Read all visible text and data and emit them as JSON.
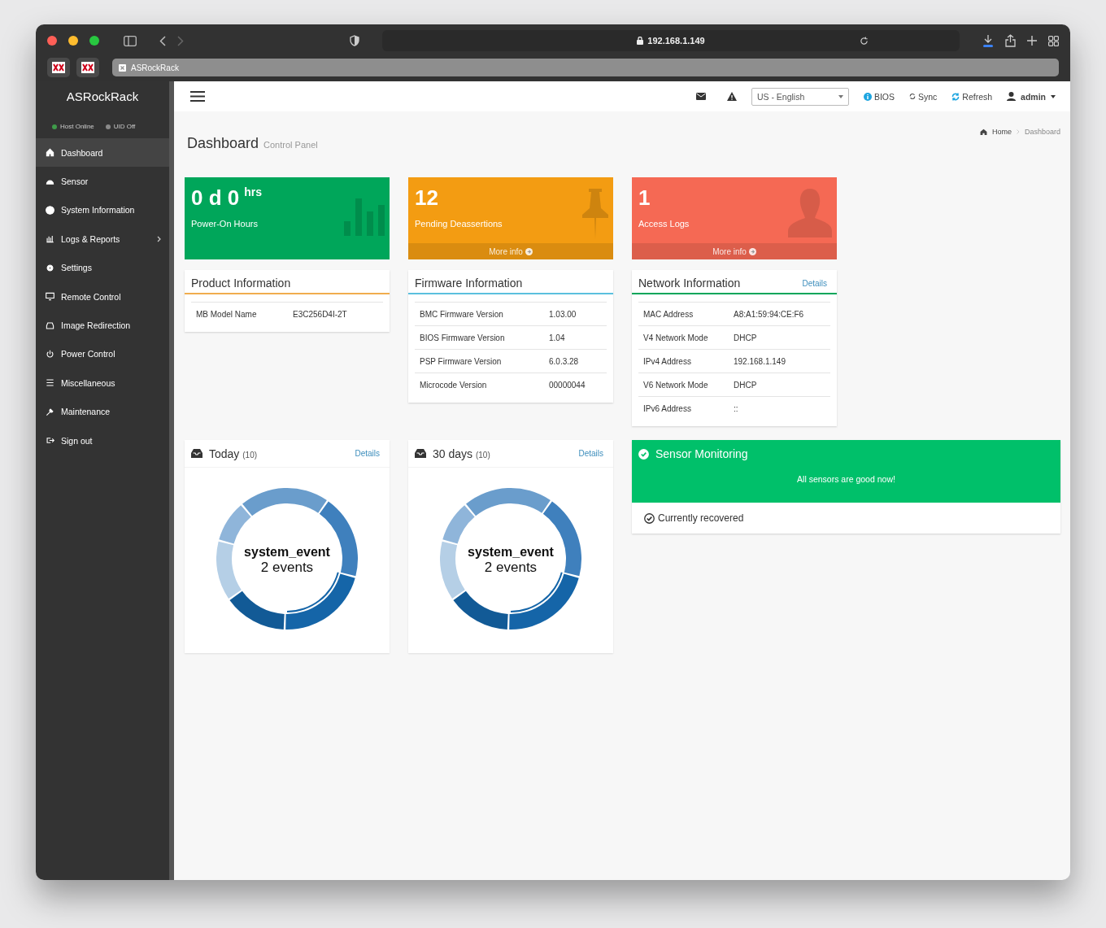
{
  "browser": {
    "url": "192.168.1.149",
    "tab_title": "ASRockRack"
  },
  "sidebar": {
    "brand": "ASRockRack",
    "status": [
      {
        "label": "Host Online",
        "color": "#3f9b4a"
      },
      {
        "label": "UID Off",
        "color": "#8a8a8a"
      }
    ],
    "items": [
      {
        "label": "Dashboard",
        "selected": true,
        "has_submenu": false
      },
      {
        "label": "Sensor",
        "selected": false,
        "has_submenu": false
      },
      {
        "label": "System Information",
        "selected": false,
        "has_submenu": false
      },
      {
        "label": "Logs & Reports",
        "selected": false,
        "has_submenu": true
      },
      {
        "label": "Settings",
        "selected": false,
        "has_submenu": false
      },
      {
        "label": "Remote Control",
        "selected": false,
        "has_submenu": false
      },
      {
        "label": "Image Redirection",
        "selected": false,
        "has_submenu": false
      },
      {
        "label": "Power Control",
        "selected": false,
        "has_submenu": false
      },
      {
        "label": "Miscellaneous",
        "selected": false,
        "has_submenu": false
      },
      {
        "label": "Maintenance",
        "selected": false,
        "has_submenu": false
      },
      {
        "label": "Sign out",
        "selected": false,
        "has_submenu": false
      }
    ]
  },
  "header": {
    "language": "US - English",
    "links": [
      "BIOS",
      "Sync",
      "Refresh"
    ],
    "user": "admin"
  },
  "page": {
    "title": "Dashboard",
    "subtitle": "Control Panel",
    "breadcrumb": [
      "Home",
      "Dashboard"
    ]
  },
  "tiles": [
    {
      "value": "0 d 0",
      "unit": "hrs",
      "label": "Power-On Hours",
      "color": "#00a65a"
    },
    {
      "value": "12",
      "label": "Pending Deassertions",
      "more_info": "More info",
      "color": "#f39c12"
    },
    {
      "value": "1",
      "label": "Access Logs",
      "more_info": "More info",
      "color": "#f56954"
    }
  ],
  "info_panels": [
    {
      "title": "Product Information",
      "color": "#f0ad4e",
      "rows": [
        {
          "label": "MB Model Name",
          "value": "E3C256D4I-2T"
        }
      ]
    },
    {
      "title": "Firmware Information",
      "color": "#5bc0de",
      "rows": [
        {
          "label": "BMC Firmware Version",
          "value": "1.03.00"
        },
        {
          "label": "BIOS Firmware Version",
          "value": "1.04"
        },
        {
          "label": "PSP Firmware Version",
          "value": "6.0.3.28"
        },
        {
          "label": "Microcode Version",
          "value": "00000044"
        }
      ]
    },
    {
      "title": "Network Information",
      "details": "Details",
      "color": "#00a65a",
      "rows": [
        {
          "label": "MAC Address",
          "value": "A8:A1:59:94:CE:F6"
        },
        {
          "label": "V4 Network Mode",
          "value": "DHCP"
        },
        {
          "label": "IPv4 Address",
          "value": "192.168.1.149"
        },
        {
          "label": "V6 Network Mode",
          "value": "DHCP"
        },
        {
          "label": "IPv6 Address",
          "value": "::"
        }
      ]
    }
  ],
  "event_panels": [
    {
      "title": "Today",
      "count": "(10)",
      "details": "Details",
      "center_title": "system_event",
      "center_text": "2 events"
    },
    {
      "title": "30 days",
      "count": "(10)",
      "details": "Details",
      "center_title": "system_event",
      "center_text": "2 events"
    }
  ],
  "sensor_monitoring": {
    "title": "Sensor Monitoring",
    "message": "All sensors are good now!",
    "status": "Currently recovered"
  }
}
